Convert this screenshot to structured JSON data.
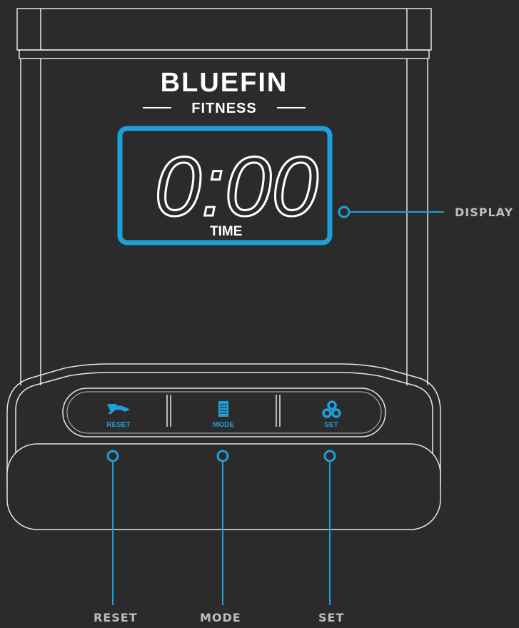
{
  "brand": {
    "name": "BLUEFIN",
    "sub": "FITNESS"
  },
  "display": {
    "value": "0:00",
    "label": "TIME"
  },
  "buttons": [
    {
      "label": "RESET",
      "icon": "reset-arrow-icon"
    },
    {
      "label": "MODE",
      "icon": "mode-list-icon"
    },
    {
      "label": "SET",
      "icon": "set-circles-icon"
    }
  ],
  "callouts": {
    "display": "DISPLAY",
    "reset": "RESET",
    "mode": "MODE",
    "set": "SET"
  },
  "colors": {
    "accent": "#1d9fdb",
    "outline": "#e0e0e0",
    "background": "#2b2b2b"
  }
}
